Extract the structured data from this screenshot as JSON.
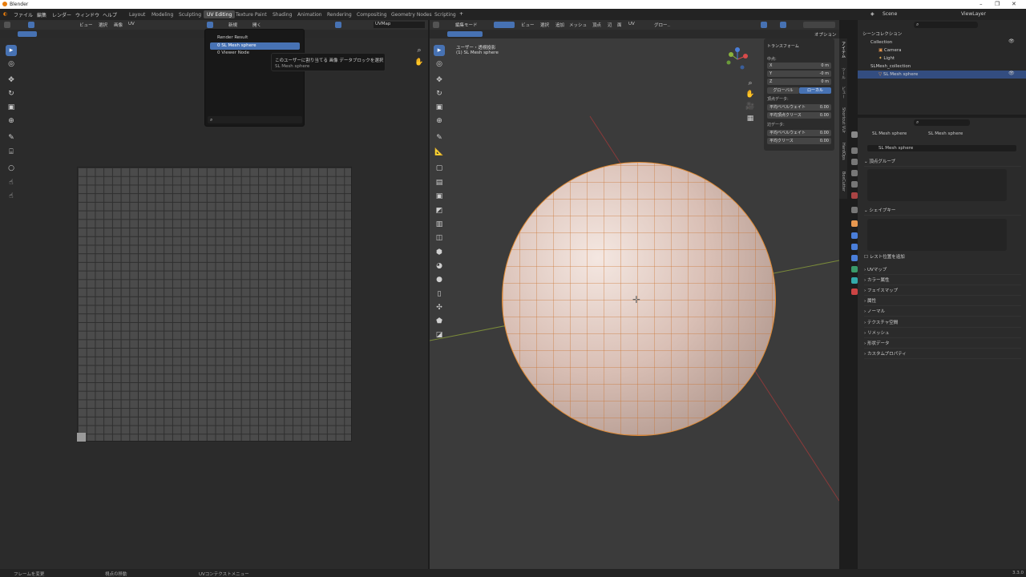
{
  "window": {
    "title": "Blender"
  },
  "menu": [
    "ファイル",
    "編集",
    "レンダー",
    "ウィンドウ",
    "ヘルプ"
  ],
  "workspaces": [
    "Layout",
    "Modeling",
    "Sculpting",
    "UV Editing",
    "Texture Paint",
    "Shading",
    "Animation",
    "Rendering",
    "Compositing",
    "Geometry Nodes",
    "Scripting"
  ],
  "uv_header": {
    "view": "ビュー",
    "select": "選択",
    "image": "画像",
    "uv": "UV",
    "new": "新規",
    "open": "開く",
    "uvmap": "UVMap"
  },
  "popup": {
    "items": [
      "Render Result",
      "0 SL Mesh sphere",
      "0 Viewer Node"
    ],
    "selected_index": 1
  },
  "tooltip": {
    "line1": "このユーザーに割り当てる 画像 データブロックを選択",
    "line2": "SL Mesh sphere"
  },
  "viewport_header": {
    "mode": "編集モード",
    "view": "ビュー",
    "select": "選択",
    "add": "追加",
    "mesh": "メッシュ",
    "vertex": "頂点",
    "edge": "辺",
    "face": "面",
    "uv": "UV",
    "global": "グロー..",
    "options": "オプション"
  },
  "viewport": {
    "view_name": "ユーザー・透視投影",
    "object_name": "(1) SL Mesh sphere"
  },
  "npanel": {
    "title": "トランスフォーム",
    "median": "中点:",
    "fields": [
      {
        "label": "X",
        "value": "0 m"
      },
      {
        "label": "Y",
        "value": "-0 m"
      },
      {
        "label": "Z",
        "value": "0 m"
      }
    ],
    "global": "グローバル",
    "local": "ローカル",
    "vertex_data": "頂点データ:",
    "vertex_fields": [
      {
        "label": "平均ベベルウェイト",
        "value": "0.00"
      },
      {
        "label": "平均頂点クリース",
        "value": "0.00"
      }
    ],
    "edge_data": "辺データ:",
    "edge_fields": [
      {
        "label": "平均ベベルウェイト",
        "value": "0.00"
      },
      {
        "label": "平均クリース",
        "value": "0.00"
      }
    ],
    "tabs": [
      "アイテム",
      "ツール",
      "ビュー",
      "Shortcut VUr",
      "HardOps",
      "BoxCutter"
    ]
  },
  "outliner": {
    "scene": "Scene",
    "view_layer": "ViewLayer",
    "rows": [
      "シーンコレクション",
      "Collection",
      "Camera",
      "Light",
      "SLMesh_collection",
      "SL Mesh sphere"
    ]
  },
  "properties": {
    "breadcrumb_obj": "SL Mesh sphere",
    "breadcrumb_mesh": "SL Mesh sphere",
    "datablock": "SL Mesh sphere",
    "sections": [
      "頂点グループ",
      "シェイプキー",
      "レスト位置を追加",
      "UVマップ",
      "カラー属性",
      "フェイスマップ",
      "属性",
      "ノーマル",
      "テクスチャ空間",
      "リメッシュ",
      "形状データ",
      "カスタムプロパティ"
    ]
  },
  "status": {
    "left": "フレームを変更",
    "mid": "視点の移動",
    "right": "UVコンテクストメニュー",
    "version": "3.3.0"
  }
}
